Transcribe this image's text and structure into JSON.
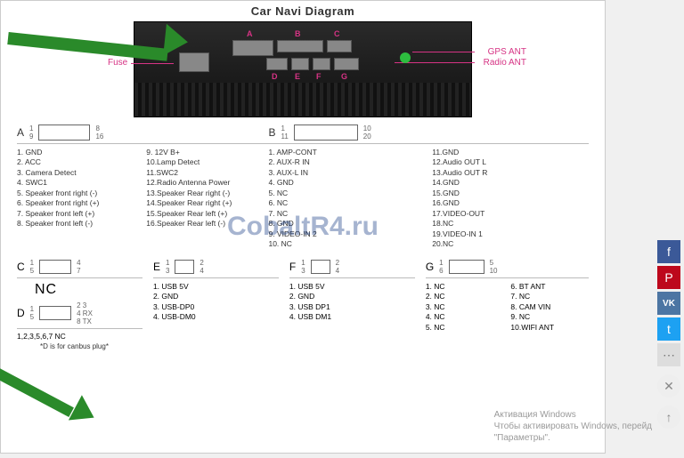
{
  "title": "Car Navi Diagram",
  "device": {
    "fuse": "Fuse",
    "gps": "GPS ANT",
    "radio": "Radio ANT",
    "letters": [
      "A",
      "B",
      "C",
      "D",
      "E",
      "F",
      "G"
    ]
  },
  "watermark": "CobaltR4.ru",
  "connectors": {
    "A": {
      "letter": "A",
      "pins_left": [
        "1",
        "9"
      ],
      "pins_right": [
        "8",
        "16"
      ],
      "col1": [
        "1. GND",
        "2. ACC",
        "3. Camera Detect",
        "4. SWC1",
        "5. Speaker front right (-)",
        "6. Speaker front right (+)",
        "7. Speaker front left (+)",
        "8. Speaker front left (-)"
      ],
      "col2": [
        "9. 12V B+",
        "10.Lamp Detect",
        "11.SWC2",
        "12.Radio Antenna Power",
        "13.Speaker Rear right (-)",
        "14.Speaker Rear right (+)",
        "15.Speaker Rear left (+)",
        "16.Speaker Rear left (-)"
      ]
    },
    "B": {
      "letter": "B",
      "pins_left": [
        "1",
        "11"
      ],
      "pins_right": [
        "10",
        "20"
      ],
      "col1": [
        "1. AMP-CONT",
        "2. AUX-R IN",
        "3. AUX-L IN",
        "4. GND",
        "5. NC",
        "6. NC",
        "7. NC",
        "8. GND",
        "9. VIDEO-IN 2",
        "10. NC"
      ],
      "col2": [
        "11.GND",
        "12.Audio OUT L",
        "13.Audio OUT R",
        "14.GND",
        "15.GND",
        "16.GND",
        "17.VIDEO-OUT",
        "18.NC",
        "19.VIDEO-IN 1",
        "20.NC"
      ]
    },
    "C": {
      "letter": "C",
      "pins_left": [
        "1",
        "5"
      ],
      "pins_right": [
        "4",
        "7"
      ],
      "label": "NC"
    },
    "D": {
      "letter": "D",
      "pins_left": [
        "1",
        "5"
      ],
      "pins_right": [
        "4",
        "8"
      ],
      "side": [
        "2 3",
        "4 RX",
        "8 TX"
      ],
      "foot": "1,2,3,5,6,7 NC",
      "note": "*D is for canbus plug*"
    },
    "E": {
      "letter": "E",
      "pins_left": [
        "1",
        "3"
      ],
      "pins_right": [
        "2",
        "4"
      ],
      "list": [
        "1. USB 5V",
        "2. GND",
        "3. USB-DP0",
        "4. USB-DM0"
      ]
    },
    "F": {
      "letter": "F",
      "pins_left": [
        "1",
        "3"
      ],
      "pins_right": [
        "2",
        "4"
      ],
      "list": [
        "1. USB 5V",
        "2. GND",
        "3. USB DP1",
        "4. USB DM1"
      ]
    },
    "G": {
      "letter": "G",
      "pins_left": [
        "1",
        "6"
      ],
      "pins_right": [
        "5",
        "10"
      ],
      "col1": [
        "1. NC",
        "2. NC",
        "3. NC",
        "4. NC",
        "5. NC"
      ],
      "col2": [
        "6. BT ANT",
        "7. NC",
        "8. CAM VIN",
        "9. NC",
        "10.WIFI ANT"
      ]
    }
  },
  "social": {
    "fb": "f",
    "pn": "P",
    "vk": "VK",
    "tw": "t",
    "more": "⋯",
    "x": "✕",
    "up": "↑"
  },
  "winact": {
    "line1": "Активация Windows",
    "line2": "Чтобы активировать Windows, перейд",
    "line3": "\"Параметры\"."
  }
}
